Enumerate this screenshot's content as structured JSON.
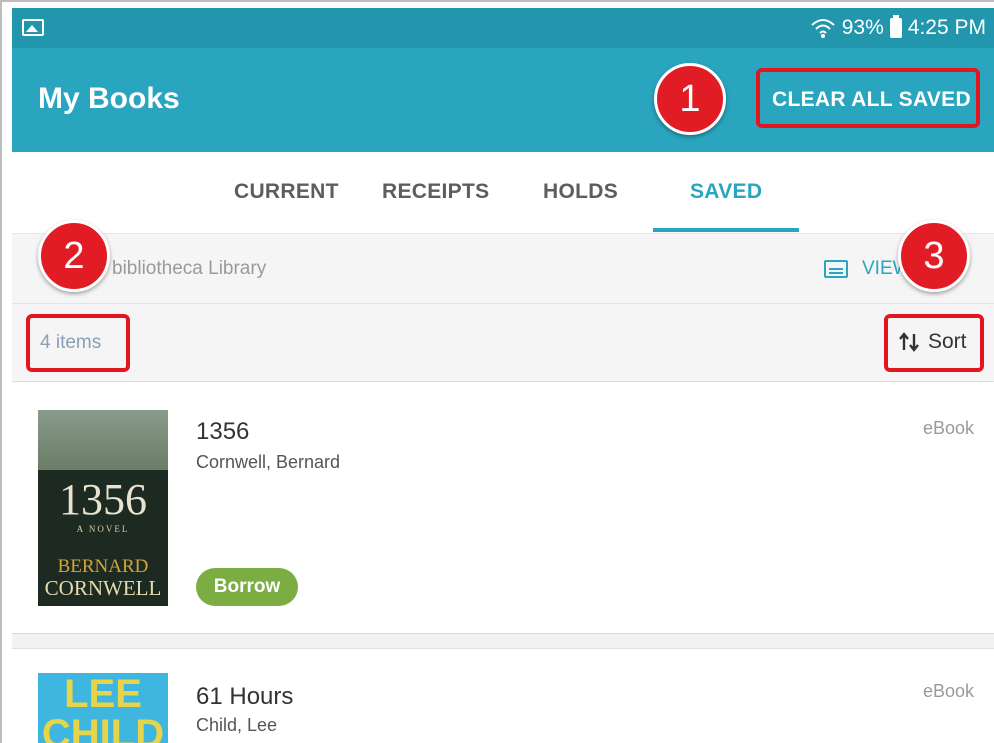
{
  "status_bar": {
    "battery": "93%",
    "time": "4:25 PM"
  },
  "app_bar": {
    "title": "My Books",
    "clear_all_label": "CLEAR ALL SAVED"
  },
  "tabs": [
    {
      "label": "CURRENT",
      "active": false
    },
    {
      "label": "RECEIPTS",
      "active": false
    },
    {
      "label": "HOLDS",
      "active": false
    },
    {
      "label": "SAVED",
      "active": true
    }
  ],
  "library": {
    "name": "bibliotheca Library",
    "view_label": "VIEW"
  },
  "list": {
    "count": "4 items",
    "sort_label": "Sort"
  },
  "books": [
    {
      "title": "1356",
      "author": "Cornwell, Bernard",
      "format": "eBook",
      "action": "Borrow",
      "cover": {
        "number": "1356",
        "subtitle": "A NOVEL",
        "author_first": "BERNARD",
        "author_last": "CORNWELL"
      }
    },
    {
      "title": "61 Hours",
      "author": "Child, Lee",
      "format": "eBook",
      "cover": {
        "line1": "LEE",
        "line2": "CHILD"
      }
    }
  ],
  "callouts": [
    "1",
    "2",
    "3"
  ],
  "colors": {
    "primary": "#2aa5bf",
    "status_bar": "#2196ad",
    "borrow": "#7cad42",
    "callout": "#e11c24"
  }
}
